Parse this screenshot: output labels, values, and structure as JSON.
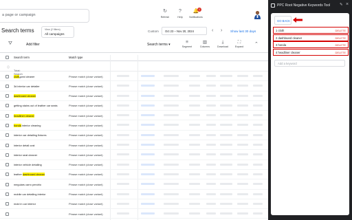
{
  "topbar": {
    "search_placeholder": "a page or campaign",
    "tools": [
      {
        "label": "Refresh",
        "icon": "refresh-icon"
      },
      {
        "label": "Help",
        "icon": "help-icon"
      },
      {
        "label": "Notifications",
        "icon": "bell-icon",
        "badge": "1"
      }
    ]
  },
  "page": {
    "title": "Search terms",
    "view_line1": "View (2 filters)",
    "view_line2": "All campaigns",
    "custom_label": "Custom",
    "date_range": "Oct 23 – Nov 20, 2024",
    "show_last": "Show last 30 days"
  },
  "toolbar": {
    "add_filter": "Add filter",
    "view_select": "Search terms",
    "tools": [
      {
        "label": "Segment",
        "icon": "segment-icon"
      },
      {
        "label": "Columns",
        "icon": "columns-icon"
      },
      {
        "label": "Download",
        "icon": "download-icon"
      },
      {
        "label": "Expand",
        "icon": "expand-icon"
      }
    ]
  },
  "table": {
    "headers": [
      "Search term",
      "Match type"
    ],
    "total_label": "Total: Search terms",
    "rows": [
      {
        "pre": "",
        "hl": "cloth",
        "post": " seat cleaner",
        "match": "Phrase match (close variant)"
      },
      {
        "pre": "3d interior car detailer",
        "hl": "",
        "post": "",
        "match": "Phrase match (close variant)"
      },
      {
        "pre": "",
        "hl": "dashboard cleaner",
        "post": "",
        "match": "Phrase match (close variant)"
      },
      {
        "pre": "getting stains out of leather car seats",
        "hl": "",
        "post": "",
        "match": "Phrase match (close variant)"
      },
      {
        "pre": "",
        "hl": "headliner cleaner",
        "post": "",
        "match": "Phrase match (close variant)"
      },
      {
        "pre": "",
        "hl": "honda",
        "post": " interior cleaning",
        "match": "Phrase match (close variant)"
      },
      {
        "pre": "interior car detailing fixtures",
        "hl": "",
        "post": "",
        "match": "Phrase match (close variant)"
      },
      {
        "pre": "interior detail cost",
        "hl": "",
        "post": "",
        "match": "Phrase match (close variant)"
      },
      {
        "pre": "interior seat cleaner",
        "hl": "",
        "post": "",
        "match": "Phrase match (close variant)"
      },
      {
        "pre": "interior vehicle detailing",
        "hl": "",
        "post": "",
        "match": "Phrase match (close variant)"
      },
      {
        "pre": "leather ",
        "hl": "dashboard cleaner",
        "post": "",
        "match": "Phrase match (close variant)"
      },
      {
        "pre": "meguiars carro pendrio",
        "hl": "",
        "post": "",
        "match": "Phrase match (close variant)"
      },
      {
        "pre": "mobile car detailing interior",
        "hl": "",
        "post": "",
        "match": "Phrase match (close variant)"
      },
      {
        "pre": "mold in car interior",
        "hl": "",
        "post": "",
        "match": "Phrase match (close variant)"
      },
      {
        "pre": "",
        "hl": "",
        "post": "",
        "match": "Phrase match (close variant)"
      }
    ]
  },
  "extension": {
    "title": "PPC Root Negative Keywords Tool",
    "go_back": "GO BACK",
    "add_placeholder": "Add a keyword",
    "accent": "#d50000",
    "keywords": [
      {
        "index": "1",
        "text": "cloth",
        "action": "DELETE"
      },
      {
        "index": "2",
        "text": "dashboard cleaner",
        "action": "DELETE"
      },
      {
        "index": "3",
        "text": "honda",
        "action": "DELETE"
      },
      {
        "index": "4",
        "text": "headliner cleaner",
        "action": "DELETE"
      }
    ]
  }
}
